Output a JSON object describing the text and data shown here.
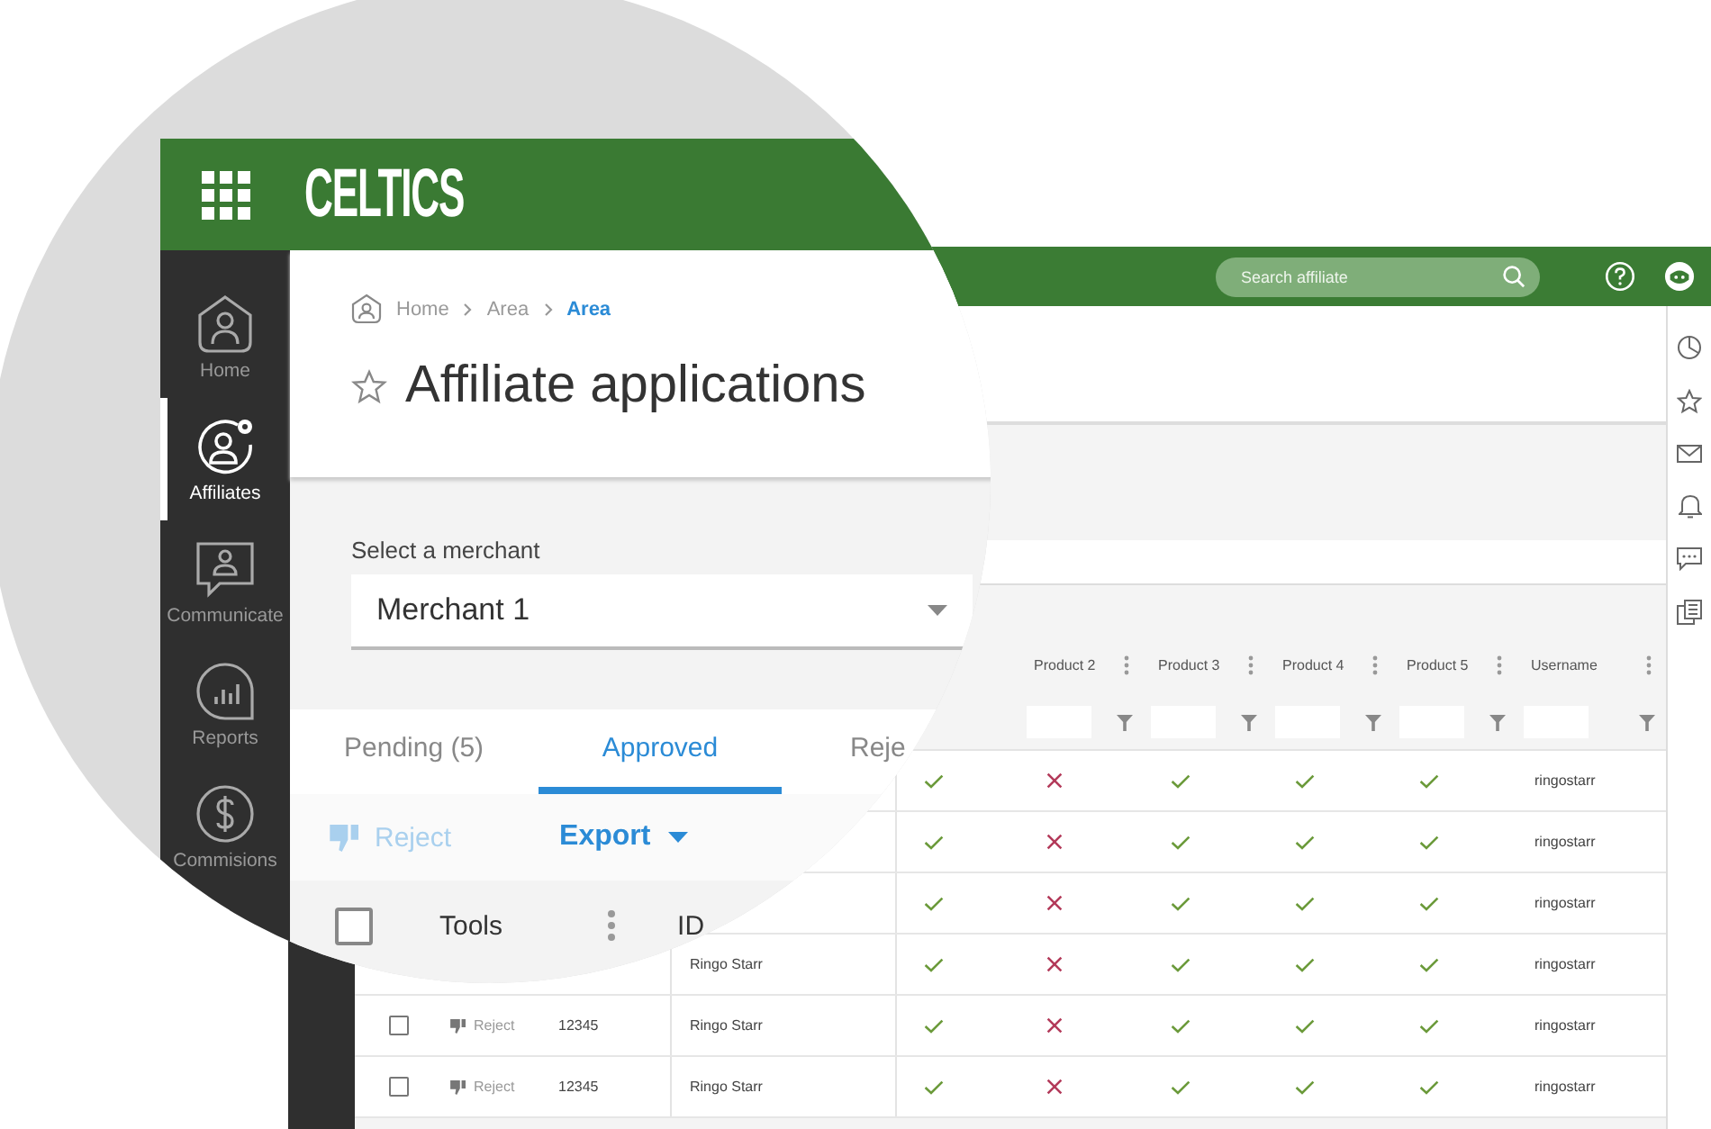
{
  "zoom": {
    "logo": "CELTICS",
    "sidebar": [
      {
        "label": "Home",
        "selected": false
      },
      {
        "label": "Affiliates",
        "selected": true
      },
      {
        "label": "Communicate",
        "selected": false
      },
      {
        "label": "Reports",
        "selected": false
      },
      {
        "label": "Commisions",
        "selected": false
      }
    ],
    "breadcrumbs": [
      {
        "label": "Home",
        "current": false
      },
      {
        "label": "Area",
        "current": false
      },
      {
        "label": "Area",
        "current": true
      }
    ],
    "title": "Affiliate applications",
    "merchant": {
      "label": "Select a merchant",
      "value": "Merchant 1"
    },
    "tabs": [
      {
        "label": "Pending (5)",
        "selected": false
      },
      {
        "label": "Approved",
        "selected": true
      },
      {
        "label": "Reje",
        "selected": false
      }
    ],
    "toolbar": {
      "reject": {
        "label": "Reject",
        "disabled": true
      },
      "export": {
        "label": "Export"
      }
    },
    "table_header": {
      "checked": false,
      "column_1": "Tools",
      "column_2": "ID"
    }
  },
  "app": {
    "search": {
      "placeholder": "Search affiliate"
    },
    "table": {
      "columns": [
        {},
        {
          "label": "Product 2"
        },
        {
          "label": "Product 3"
        },
        {
          "label": "Product 4"
        },
        {
          "label": "Product 5"
        },
        {
          "label": "Username"
        }
      ],
      "rows": [
        {
          "products": [
            true,
            false,
            true,
            true,
            true
          ],
          "username": "ringostarr"
        },
        {
          "products": [
            true,
            false,
            true,
            true,
            true
          ],
          "username": "ringostarr"
        },
        {
          "products": [
            true,
            false,
            true,
            true,
            true
          ],
          "username": "ringostarr"
        },
        {
          "name": "Ringo Starr",
          "products": [
            true,
            false,
            true,
            true,
            true
          ],
          "username": "ringostarr"
        },
        {
          "checked": false,
          "reject": "Reject",
          "id": "12345",
          "name": "Ringo Starr",
          "products": [
            true,
            false,
            true,
            true,
            true
          ],
          "username": "ringostarr"
        },
        {
          "checked": false,
          "reject": "Reject",
          "id": "12345",
          "name": "Ringo Starr",
          "products": [
            true,
            false,
            true,
            true,
            true
          ],
          "username": "ringostarr"
        }
      ]
    }
  }
}
